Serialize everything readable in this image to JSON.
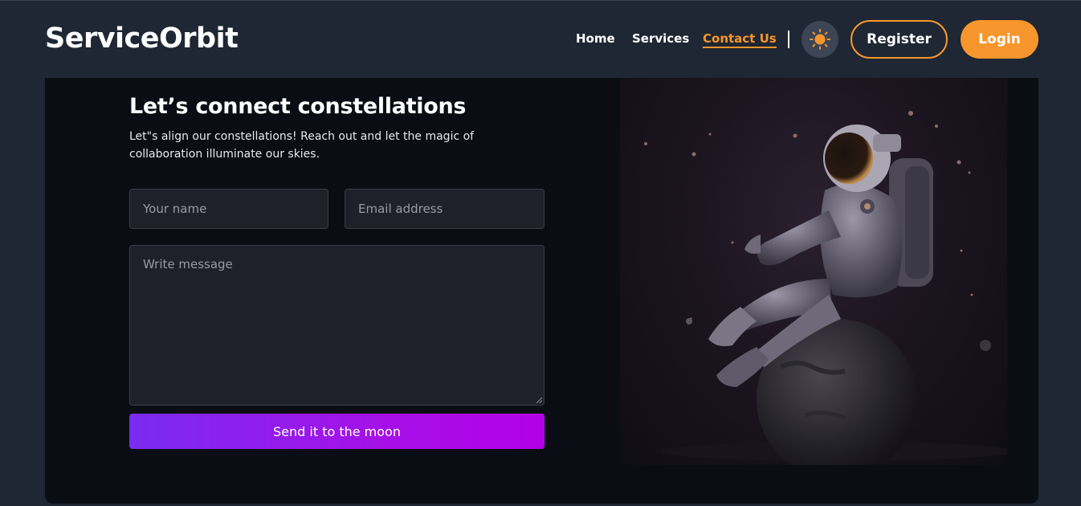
{
  "brand": {
    "logo": "ServiceOrbit"
  },
  "nav": {
    "links": [
      {
        "label": "Home"
      },
      {
        "label": "Services"
      },
      {
        "label": "Contact Us",
        "active": true
      }
    ],
    "theme_icon": "sun-icon",
    "register_label": "Register",
    "login_label": "Login"
  },
  "contact": {
    "heading": "Let’s connect constellations",
    "subtext": "Let\"s align our constellations! Reach out and let the magic of collaboration illuminate our skies.",
    "name_placeholder": "Your name",
    "email_placeholder": "Email address",
    "message_placeholder": "Write message",
    "submit_label": "Send it to the moon"
  },
  "illustration": {
    "icon": "astronaut-illustration"
  },
  "colors": {
    "accent": "#f7962d",
    "background": "#1e2733",
    "card": "#0b0d15",
    "gradient_start": "#7a2cf0",
    "gradient_end": "#b300e6"
  }
}
